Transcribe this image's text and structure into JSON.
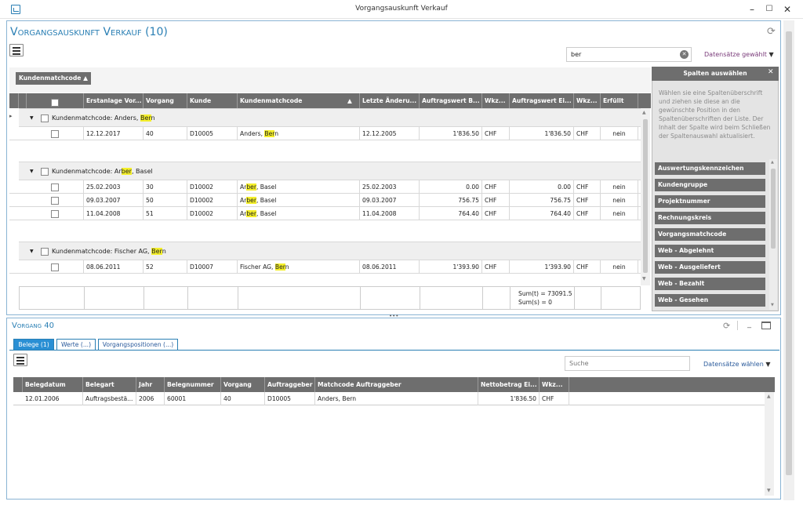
{
  "window": {
    "title": "Vorgangsauskunft Verkauf"
  },
  "main": {
    "title": "Vorgangsauskunft Verkauf (10)",
    "search_value": "ber",
    "datasets_label": "Datensätze gewählt",
    "group_chip": "Kundenmatchcode",
    "columns": [
      "Erstanlage Vor...",
      "Vorgang",
      "Kunde",
      "Kundenmatchcode",
      "Letzte Änderu...",
      "Auftragswert B...",
      "Wkz...",
      "Auftragswert Ei...",
      "Wkz...",
      "Erfüllt"
    ],
    "groups": [
      {
        "label_pre": "Kundenmatchcode: Anders, ",
        "label_hl": "Ber",
        "label_post": "n",
        "rows": [
          {
            "date": "12.12.2017",
            "vorgang": "40",
            "kunde": "D10005",
            "match_pre": "Anders, ",
            "match_hl": "Ber",
            "match_post": "n",
            "letzte": "12.12.2005",
            "wert_b": "1'836.50",
            "wkz1": "CHF",
            "wert_e": "1'836.50",
            "wkz2": "CHF",
            "erfuellt": "nein"
          }
        ]
      },
      {
        "label_pre": "Kundenmatchcode: Ar",
        "label_hl": "ber",
        "label_post": ", Basel",
        "rows": [
          {
            "date": "25.02.2003",
            "vorgang": "30",
            "kunde": "D10002",
            "match_pre": "Ar",
            "match_hl": "ber",
            "match_post": ", Basel",
            "letzte": "25.02.2003",
            "wert_b": "0.00",
            "wkz1": "CHF",
            "wert_e": "0.00",
            "wkz2": "CHF",
            "erfuellt": "nein"
          },
          {
            "date": "09.03.2007",
            "vorgang": "50",
            "kunde": "D10002",
            "match_pre": "Ar",
            "match_hl": "ber",
            "match_post": ", Basel",
            "letzte": "09.03.2007",
            "wert_b": "756.75",
            "wkz1": "CHF",
            "wert_e": "756.75",
            "wkz2": "CHF",
            "erfuellt": "nein"
          },
          {
            "date": "11.04.2008",
            "vorgang": "51",
            "kunde": "D10002",
            "match_pre": "Ar",
            "match_hl": "ber",
            "match_post": ", Basel",
            "letzte": "11.04.2008",
            "wert_b": "764.40",
            "wkz1": "CHF",
            "wert_e": "764.40",
            "wkz2": "CHF",
            "erfuellt": "nein"
          }
        ]
      },
      {
        "label_pre": "Kundenmatchcode: Fischer AG, ",
        "label_hl": "Ber",
        "label_post": "n",
        "rows": [
          {
            "date": "08.06.2011",
            "vorgang": "52",
            "kunde": "D10007",
            "match_pre": "Fischer AG, ",
            "match_hl": "Ber",
            "match_post": "n",
            "letzte": "08.06.2011",
            "wert_b": "1'393.90",
            "wkz1": "CHF",
            "wert_e": "1'393.90",
            "wkz2": "CHF",
            "erfuellt": "nein"
          }
        ]
      }
    ],
    "sum_t": "Sum(t) = 73091.5",
    "sum_s": "Sum(s) = 0"
  },
  "column_chooser": {
    "title": "Spalten auswählen",
    "hint": "Wählen sie eine Spaltenüberschrift und ziehen sie diese an die gewünschte Position in den Spaltenüberschriften der Liste. Der Inhalt der Spalte wird beim Schließen der Spaltenauswahl aktualisiert.",
    "items": [
      "Auswertungskennzeichen",
      "Kundengruppe",
      "Projektnummer",
      "Rechnungskreis",
      "Vorgangsmatchcode",
      "Web - Abgelehnt",
      "Web - Ausgeliefert",
      "Web - Bezahlt",
      "Web - Gesehen"
    ]
  },
  "detail": {
    "title": "Vorgang 40",
    "tabs": [
      "Belege (1)",
      "Werte (...)",
      "Vorgangspositionen (...)"
    ],
    "search_placeholder": "Suche",
    "datasets_label": "Datensätze wählen",
    "columns": [
      "Belegdatum",
      "Belegart",
      "Jahr",
      "Belegnummer",
      "Vorgang",
      "Auftraggeber",
      "Matchcode Auftraggeber",
      "Nettobetrag Ei...",
      "Wkz..."
    ],
    "rows": [
      {
        "datum": "12.01.2006",
        "art": "Auftragsbestä...",
        "jahr": "2006",
        "nummer": "60001",
        "vorgang": "40",
        "auftraggeber": "D10005",
        "matchcode": "Anders, Bern",
        "betrag": "1'836.50",
        "wkz": "CHF"
      }
    ]
  }
}
